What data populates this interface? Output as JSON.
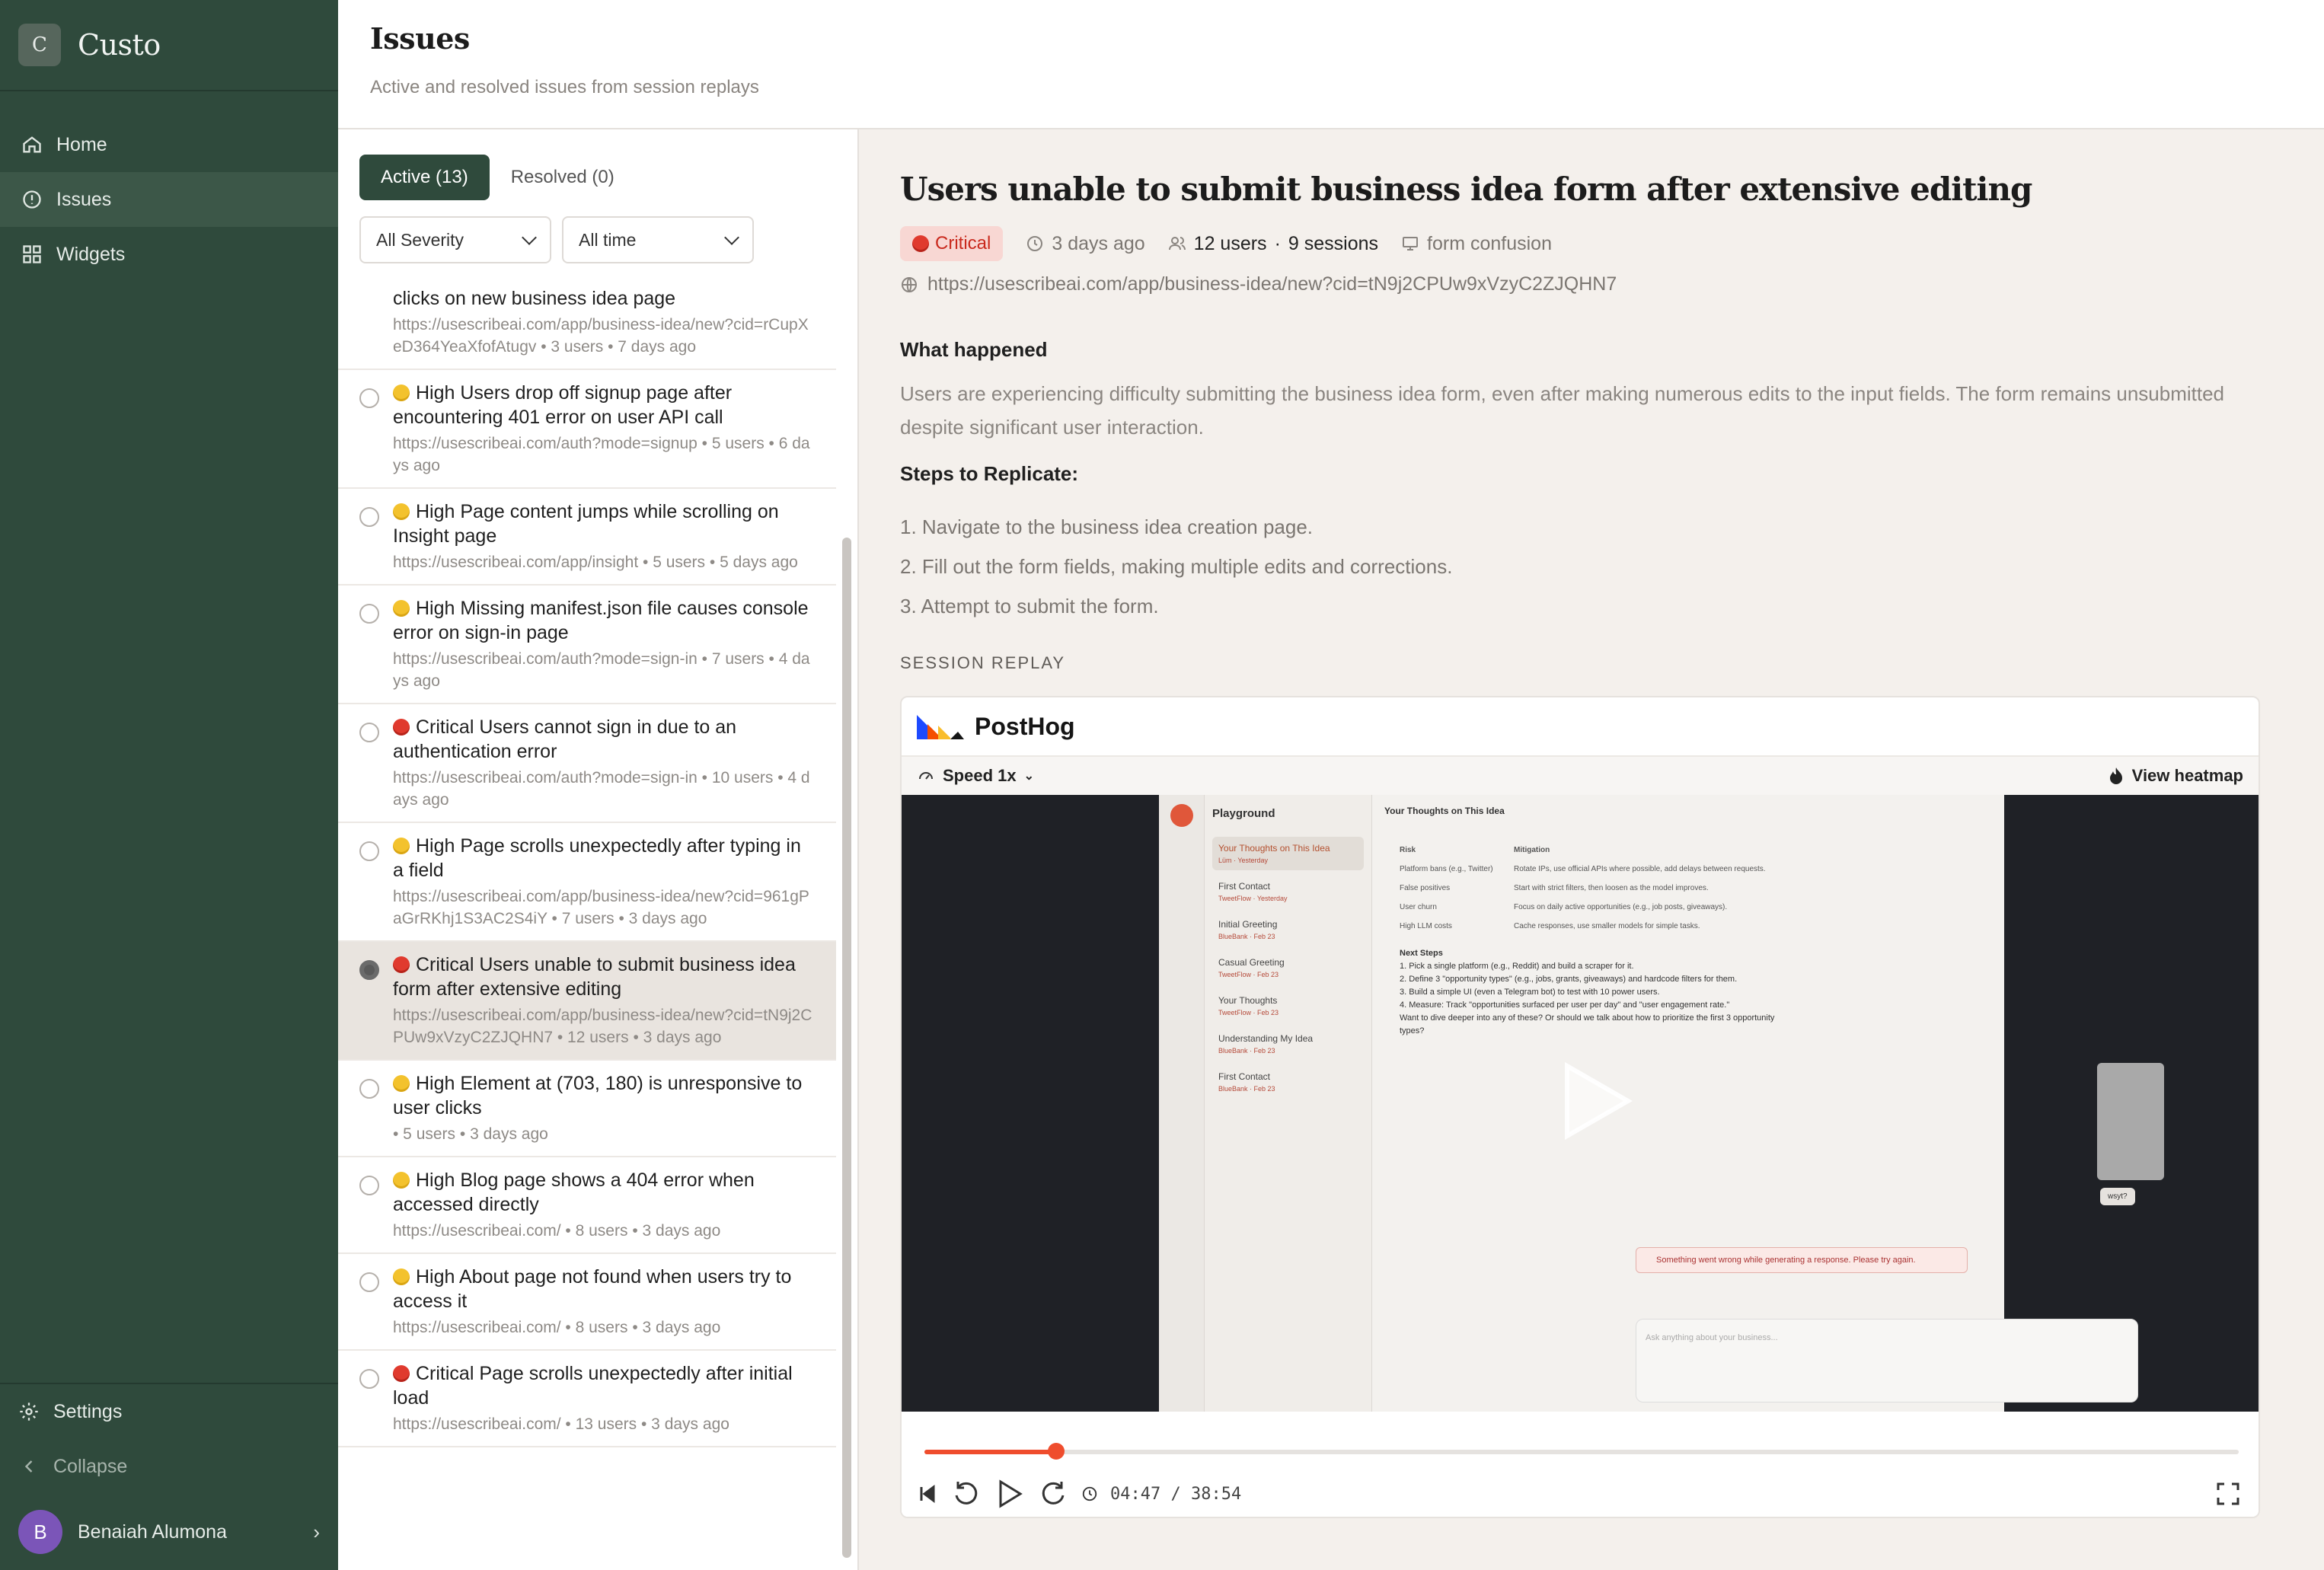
{
  "app": {
    "logo_letter": "C",
    "name": "Custo"
  },
  "sidebar": {
    "items": [
      {
        "label": "Home",
        "icon": "home-icon"
      },
      {
        "label": "Issues",
        "icon": "alert-circle-icon"
      },
      {
        "label": "Widgets",
        "icon": "grid-icon"
      }
    ],
    "settings_label": "Settings",
    "collapse_label": "Collapse",
    "user": {
      "initial": "B",
      "name": "Benaiah Alumona"
    }
  },
  "header": {
    "title": "Issues",
    "subtitle": "Active and resolved issues from session replays"
  },
  "list": {
    "tabs": [
      {
        "label": "Active (13)"
      },
      {
        "label": "Resolved (0)"
      }
    ],
    "severity_filter": "All Severity",
    "time_filter": "All time",
    "issues": [
      {
        "severity": "",
        "title": "clicks on new business idea page",
        "meta": "https://usescribeai.com/app/business-idea/new?cid=rCupXeD364YeaXfofAtugv • 3 users • 7 days ago"
      },
      {
        "severity": "High",
        "title": "Users drop off signup page after encountering 401 error on user API call",
        "meta": "https://usescribeai.com/auth?mode=signup • 5 users • 6 days ago"
      },
      {
        "severity": "High",
        "title": "Page content jumps while scrolling on Insight page",
        "meta": "https://usescribeai.com/app/insight • 5 users • 5 days ago"
      },
      {
        "severity": "High",
        "title": "Missing manifest.json file causes console error on sign-in page",
        "meta": "https://usescribeai.com/auth?mode=sign-in • 7 users • 4 days ago"
      },
      {
        "severity": "Critical",
        "title": "Users cannot sign in due to an authentication error",
        "meta": "https://usescribeai.com/auth?mode=sign-in • 10 users • 4 days ago"
      },
      {
        "severity": "High",
        "title": "Page scrolls unexpectedly after typing in a field",
        "meta": "https://usescribeai.com/app/business-idea/new?cid=961gPaGrRKhj1S3AC2S4iY • 7 users • 3 days ago"
      },
      {
        "severity": "Critical",
        "title": "Users unable to submit business idea form after extensive editing",
        "meta": "https://usescribeai.com/app/business-idea/new?cid=tN9j2CPUw9xVzyC2ZJQHN7 • 12 users • 3 days ago"
      },
      {
        "severity": "High",
        "title": "Element at (703, 180) is unresponsive to user clicks",
        "meta": "• 5 users • 3 days ago"
      },
      {
        "severity": "High",
        "title": "Blog page shows a 404 error when accessed directly",
        "meta": "https://usescribeai.com/ • 8 users • 3 days ago"
      },
      {
        "severity": "High",
        "title": "About page not found when users try to access it",
        "meta": "https://usescribeai.com/ • 8 users • 3 days ago"
      },
      {
        "severity": "Critical",
        "title": "Page scrolls unexpectedly after initial load",
        "meta": "https://usescribeai.com/ • 13 users • 3 days ago"
      }
    ]
  },
  "detail": {
    "title": "Users unable to submit business idea form after extensive editing",
    "severity": "Critical",
    "time": "3 days ago",
    "users": "12 users",
    "sessions": "9 sessions",
    "category": "form confusion",
    "url": "https://usescribeai.com/app/business-idea/new?cid=tN9j2CPUw9xVzyC2ZJQHN7",
    "what_happened_title": "What happened",
    "what_happened": "Users are experiencing difficulty submitting the business idea form, even after making numerous edits to the input fields. The form remains unsubmitted despite significant user interaction.",
    "steps_title": "Steps to Replicate:",
    "steps": [
      "1. Navigate to the business idea creation page.",
      "2. Fill out the form fields, making multiple edits and corrections.",
      "3. Attempt to submit the form."
    ],
    "replay_label": "SESSION REPLAY"
  },
  "player": {
    "brand": "PostHog",
    "speed": "Speed 1x",
    "heatmap": "View heatmap",
    "time": "04:47 / 38:54",
    "progress": 0.1,
    "mock": {
      "sidebar_title": "Playground",
      "chats": [
        {
          "title": "Your Thoughts on This Idea",
          "tag": "Lüm · Yesterday"
        },
        {
          "title": "First Contact",
          "tag": "TweetFlow · Yesterday"
        },
        {
          "title": "Initial Greeting",
          "tag": "BlueBank · Feb 23"
        },
        {
          "title": "Casual Greeting",
          "tag": "TweetFlow · Feb 23"
        },
        {
          "title": "Your Thoughts",
          "tag": "TweetFlow · Feb 23"
        },
        {
          "title": "Understanding My Idea",
          "tag": "BlueBank · Feb 23"
        },
        {
          "title": "First Contact",
          "tag": "BlueBank · Feb 23"
        }
      ],
      "header": "Your Thoughts on This Idea",
      "table_rows": [
        [
          "Risk",
          "Mitigation"
        ],
        [
          "Platform bans (e.g., Twitter)",
          "Rotate IPs, use official APIs where possible, add delays between requests."
        ],
        [
          "False positives",
          "Start with strict filters, then loosen as the model improves."
        ],
        [
          "User churn",
          "Focus on daily active opportunities (e.g., job posts, giveaways)."
        ],
        [
          "High LLM costs",
          "Cache responses, use smaller models for simple tasks."
        ]
      ],
      "next_steps_title": "Next Steps",
      "next_steps": [
        "1. Pick a single platform (e.g., Reddit) and build a scraper for it.",
        "2. Define 3 \"opportunity types\" (e.g., jobs, grants, giveaways) and hardcode filters for them.",
        "3. Build a simple UI (even a Telegram bot) to test with 10 power users.",
        "4. Measure: Track \"opportunities surfaced per user per day\" and \"user engagement rate.\"",
        "Want to dive deeper into any of these? Or should we talk about how to prioritize the first 3 opportunity types?"
      ],
      "chat_bubble": "wsyt?",
      "error": "Something went wrong while generating a response. Please try again.",
      "input_placeholder": "Ask anything about your business..."
    }
  },
  "colors": {
    "sidebar_bg": "#2f4a3c",
    "accent": "#2f4a3c",
    "critical": "#e03a2e",
    "high": "#f3c22d",
    "timeline": "#ef4d2d"
  }
}
